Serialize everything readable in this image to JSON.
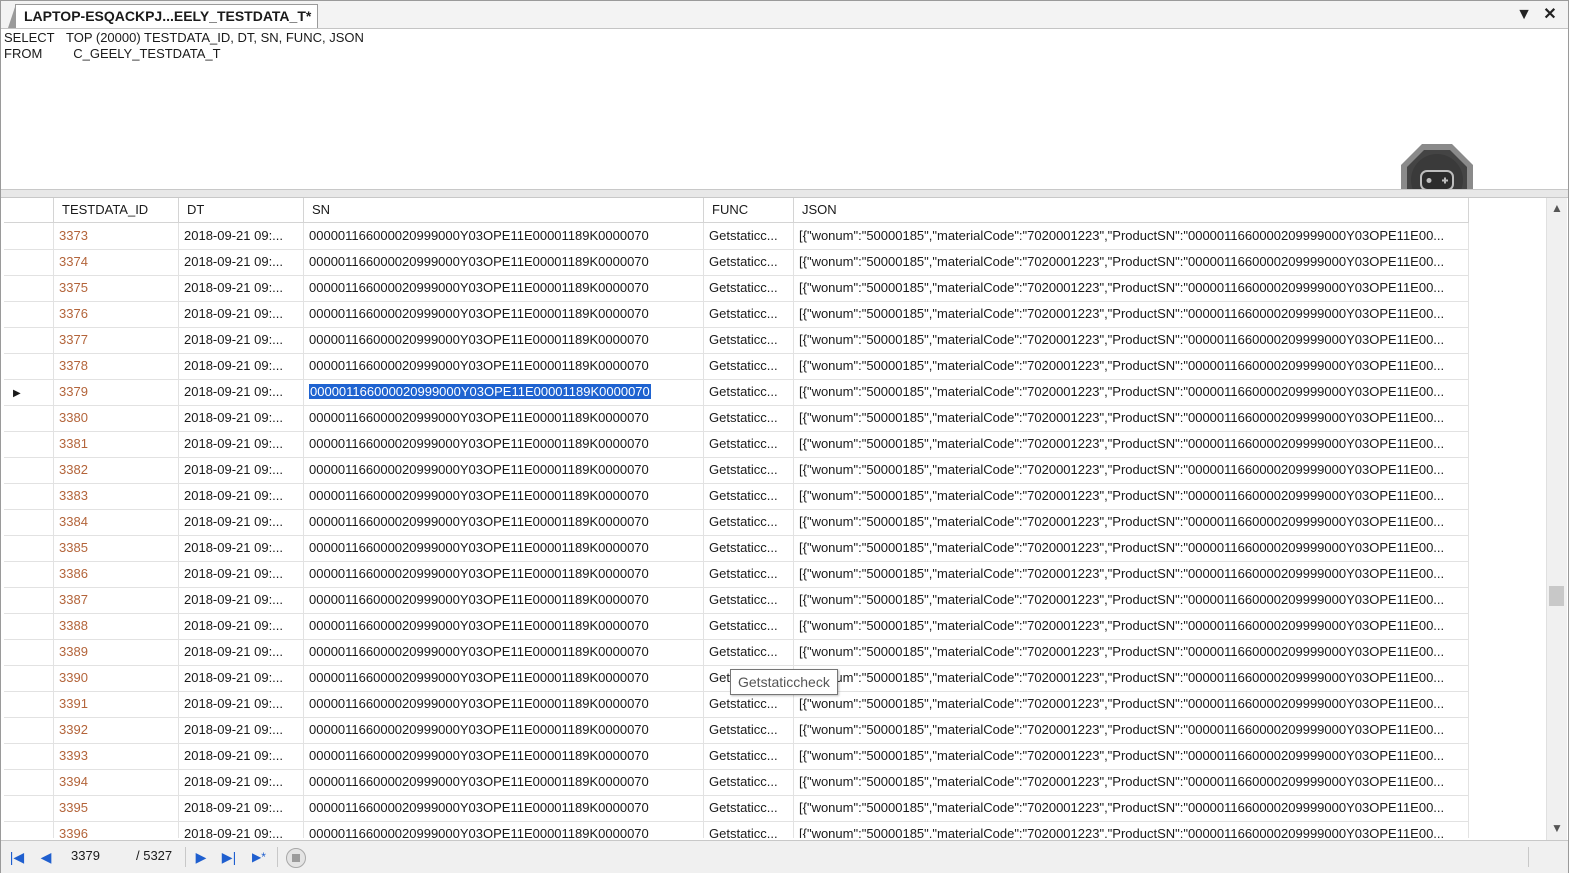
{
  "tab": {
    "title": "LAPTOP-ESQACKPJ...EELY_TESTDATA_T*"
  },
  "window_controls": {
    "dropdown_glyph": "▼",
    "close_glyph": "✕"
  },
  "sql": [
    {
      "keyword": "SELECT",
      "text": "TOP (20000) TESTDATA_ID, DT, SN, FUNC, JSON"
    },
    {
      "keyword": "FROM",
      "text": "  C_GEELY_TESTDATA_T"
    }
  ],
  "grid": {
    "columns": [
      "",
      "TESTDATA_ID",
      "DT",
      "SN",
      "FUNC",
      "JSON"
    ],
    "selected_row_id": "3379",
    "rows": [
      {
        "id": "3373",
        "dt": "2018-09-21 09:...",
        "sn": "000001166000020999000Y03OPE11E00001189K0000070",
        "func": "Getstaticc...",
        "json": "[{\"wonum\":\"50000185\",\"materialCode\":\"7020001223\",\"ProductSN\":\"0000011660000209999000Y03OPE11E00..."
      },
      {
        "id": "3374",
        "dt": "2018-09-21 09:...",
        "sn": "000001166000020999000Y03OPE11E00001189K0000070",
        "func": "Getstaticc...",
        "json": "[{\"wonum\":\"50000185\",\"materialCode\":\"7020001223\",\"ProductSN\":\"0000011660000209999000Y03OPE11E00..."
      },
      {
        "id": "3375",
        "dt": "2018-09-21 09:...",
        "sn": "000001166000020999000Y03OPE11E00001189K0000070",
        "func": "Getstaticc...",
        "json": "[{\"wonum\":\"50000185\",\"materialCode\":\"7020001223\",\"ProductSN\":\"0000011660000209999000Y03OPE11E00..."
      },
      {
        "id": "3376",
        "dt": "2018-09-21 09:...",
        "sn": "000001166000020999000Y03OPE11E00001189K0000070",
        "func": "Getstaticc...",
        "json": "[{\"wonum\":\"50000185\",\"materialCode\":\"7020001223\",\"ProductSN\":\"0000011660000209999000Y03OPE11E00..."
      },
      {
        "id": "3377",
        "dt": "2018-09-21 09:...",
        "sn": "000001166000020999000Y03OPE11E00001189K0000070",
        "func": "Getstaticc...",
        "json": "[{\"wonum\":\"50000185\",\"materialCode\":\"7020001223\",\"ProductSN\":\"0000011660000209999000Y03OPE11E00..."
      },
      {
        "id": "3378",
        "dt": "2018-09-21 09:...",
        "sn": "000001166000020999000Y03OPE11E00001189K0000070",
        "func": "Getstaticc...",
        "json": "[{\"wonum\":\"50000185\",\"materialCode\":\"7020001223\",\"ProductSN\":\"0000011660000209999000Y03OPE11E00..."
      },
      {
        "id": "3379",
        "dt": "2018-09-21 09:...",
        "sn": "000001166000020999000Y03OPE11E00001189K0000070",
        "func": "Getstaticc...",
        "json": "[{\"wonum\":\"50000185\",\"materialCode\":\"7020001223\",\"ProductSN\":\"0000011660000209999000Y03OPE11E00...",
        "selected": true
      },
      {
        "id": "3380",
        "dt": "2018-09-21 09:...",
        "sn": "000001166000020999000Y03OPE11E00001189K0000070",
        "func": "Getstaticc...",
        "json": "[{\"wonum\":\"50000185\",\"materialCode\":\"7020001223\",\"ProductSN\":\"0000011660000209999000Y03OPE11E00..."
      },
      {
        "id": "3381",
        "dt": "2018-09-21 09:...",
        "sn": "000001166000020999000Y03OPE11E00001189K0000070",
        "func": "Getstaticc...",
        "json": "[{\"wonum\":\"50000185\",\"materialCode\":\"7020001223\",\"ProductSN\":\"0000011660000209999000Y03OPE11E00..."
      },
      {
        "id": "3382",
        "dt": "2018-09-21 09:...",
        "sn": "000001166000020999000Y03OPE11E00001189K0000070",
        "func": "Getstaticc...",
        "json": "[{\"wonum\":\"50000185\",\"materialCode\":\"7020001223\",\"ProductSN\":\"0000011660000209999000Y03OPE11E00..."
      },
      {
        "id": "3383",
        "dt": "2018-09-21 09:...",
        "sn": "000001166000020999000Y03OPE11E00001189K0000070",
        "func": "Getstaticc...",
        "json": "[{\"wonum\":\"50000185\",\"materialCode\":\"7020001223\",\"ProductSN\":\"0000011660000209999000Y03OPE11E00..."
      },
      {
        "id": "3384",
        "dt": "2018-09-21 09:...",
        "sn": "000001166000020999000Y03OPE11E00001189K0000070",
        "func": "Getstaticc...",
        "json": "[{\"wonum\":\"50000185\",\"materialCode\":\"7020001223\",\"ProductSN\":\"0000011660000209999000Y03OPE11E00..."
      },
      {
        "id": "3385",
        "dt": "2018-09-21 09:...",
        "sn": "000001166000020999000Y03OPE11E00001189K0000070",
        "func": "Getstaticc...",
        "json": "[{\"wonum\":\"50000185\",\"materialCode\":\"7020001223\",\"ProductSN\":\"0000011660000209999000Y03OPE11E00..."
      },
      {
        "id": "3386",
        "dt": "2018-09-21 09:...",
        "sn": "000001166000020999000Y03OPE11E00001189K0000070",
        "func": "Getstaticc...",
        "json": "[{\"wonum\":\"50000185\",\"materialCode\":\"7020001223\",\"ProductSN\":\"0000011660000209999000Y03OPE11E00..."
      },
      {
        "id": "3387",
        "dt": "2018-09-21 09:...",
        "sn": "000001166000020999000Y03OPE11E00001189K0000070",
        "func": "Getstaticc...",
        "json": "[{\"wonum\":\"50000185\",\"materialCode\":\"7020001223\",\"ProductSN\":\"0000011660000209999000Y03OPE11E00..."
      },
      {
        "id": "3388",
        "dt": "2018-09-21 09:...",
        "sn": "000001166000020999000Y03OPE11E00001189K0000070",
        "func": "Getstaticc...",
        "json": "[{\"wonum\":\"50000185\",\"materialCode\":\"7020001223\",\"ProductSN\":\"0000011660000209999000Y03OPE11E00..."
      },
      {
        "id": "3389",
        "dt": "2018-09-21 09:...",
        "sn": "000001166000020999000Y03OPE11E00001189K0000070",
        "func": "Getstaticc...",
        "json": "[{\"wonum\":\"50000185\",\"materialCode\":\"7020001223\",\"ProductSN\":\"0000011660000209999000Y03OPE11E00..."
      },
      {
        "id": "3390",
        "dt": "2018-09-21 09:...",
        "sn": "000001166000020999000Y03OPE11E00001189K0000070",
        "func": "Getstaticc...",
        "json": "[{\"wonum\":\"50000185\",\"materialCode\":\"7020001223\",\"ProductSN\":\"0000011660000209999000Y03OPE11E00..."
      },
      {
        "id": "3391",
        "dt": "2018-09-21 09:...",
        "sn": "000001166000020999000Y03OPE11E00001189K0000070",
        "func": "Getstaticc...",
        "json": "[{\"wonum\":\"50000185\",\"materialCode\":\"7020001223\",\"ProductSN\":\"0000011660000209999000Y03OPE11E00..."
      },
      {
        "id": "3392",
        "dt": "2018-09-21 09:...",
        "sn": "000001166000020999000Y03OPE11E00001189K0000070",
        "func": "Getstaticc...",
        "json": "[{\"wonum\":\"50000185\",\"materialCode\":\"7020001223\",\"ProductSN\":\"0000011660000209999000Y03OPE11E00..."
      },
      {
        "id": "3393",
        "dt": "2018-09-21 09:...",
        "sn": "000001166000020999000Y03OPE11E00001189K0000070",
        "func": "Getstaticc...",
        "json": "[{\"wonum\":\"50000185\",\"materialCode\":\"7020001223\",\"ProductSN\":\"0000011660000209999000Y03OPE11E00..."
      },
      {
        "id": "3394",
        "dt": "2018-09-21 09:...",
        "sn": "000001166000020999000Y03OPE11E00001189K0000070",
        "func": "Getstaticc...",
        "json": "[{\"wonum\":\"50000185\",\"materialCode\":\"7020001223\",\"ProductSN\":\"0000011660000209999000Y03OPE11E00..."
      },
      {
        "id": "3395",
        "dt": "2018-09-21 09:...",
        "sn": "000001166000020999000Y03OPE11E00001189K0000070",
        "func": "Getstaticc...",
        "json": "[{\"wonum\":\"50000185\",\"materialCode\":\"7020001223\",\"ProductSN\":\"0000011660000209999000Y03OPE11E00..."
      },
      {
        "id": "3396",
        "dt": "2018-09-21 09:...",
        "sn": "000001166000020999000Y03OPE11E00001189K0000070",
        "func": "Getstaticc...",
        "json": "[{\"wonum\":\"50000185\",\"materialCode\":\"7020001223\",\"ProductSN\":\"0000011660000209999000Y03OPE11E00..."
      }
    ]
  },
  "tooltip": {
    "text": "Getstaticcheck"
  },
  "navigator": {
    "current_record": "3379",
    "total_records": "/ 5327",
    "first_glyph": "|◀",
    "prev_glyph": "◀",
    "next_glyph": "▶",
    "last_glyph": "▶|",
    "new_glyph": "▶*"
  },
  "colors": {
    "accent": "#1f63d0",
    "id_text": "#b3643a",
    "nav_icon": "#1f5fcf"
  },
  "icons": {
    "robot": "game-controller-robot-icon",
    "row_indicator": "current-row-triangle-icon"
  }
}
